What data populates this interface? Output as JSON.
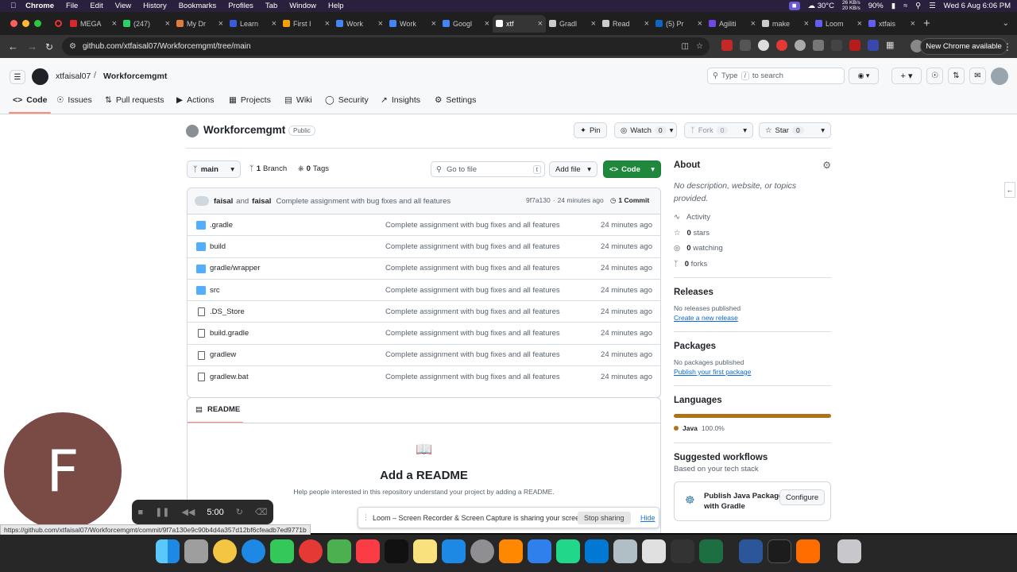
{
  "macmenu": {
    "app": "Chrome",
    "items": [
      "File",
      "Edit",
      "View",
      "History",
      "Bookmarks",
      "Profiles",
      "Tab",
      "Window",
      "Help"
    ],
    "weather": "30°C",
    "net_up": "26 KB/s",
    "net_down": "20 KB/s",
    "battery": "90%",
    "datetime": "Wed 6 Aug  6:06 PM"
  },
  "tabs": [
    {
      "title": "MEGA",
      "color": "#d9272e"
    },
    {
      "title": "(247)",
      "color": "#25d366"
    },
    {
      "title": "My Dr",
      "color": "#e07b39"
    },
    {
      "title": "Learn",
      "color": "#3b5bdb"
    },
    {
      "title": "First I",
      "color": "#f59f00"
    },
    {
      "title": "Work",
      "color": "#4285f4"
    },
    {
      "title": "Work",
      "color": "#4285f4"
    },
    {
      "title": "Googl",
      "color": "#4285f4"
    },
    {
      "title": "xtf",
      "color": "#ffffff"
    },
    {
      "title": "Gradl",
      "color": "#cccccc"
    },
    {
      "title": "Read",
      "color": "#cccccc"
    },
    {
      "title": "(5) Pr",
      "color": "#0a66c2"
    },
    {
      "title": "Agiliti",
      "color": "#7048e8"
    },
    {
      "title": "make",
      "color": "#cccccc"
    },
    {
      "title": "Loom",
      "color": "#625df5"
    },
    {
      "title": "xtfais",
      "color": "#625df5"
    }
  ],
  "address": {
    "url": "github.com/xtfaisal07/Workforcemgmt/tree/main",
    "new_chrome": "New Chrome available"
  },
  "header": {
    "owner": "xtfaisal07",
    "slash": "/",
    "repo": "Workforcemgmt",
    "search_placeholder_pre": "Type",
    "search_key": "/",
    "search_placeholder_post": "to search"
  },
  "nav": [
    "Code",
    "Issues",
    "Pull requests",
    "Actions",
    "Projects",
    "Wiki",
    "Security",
    "Insights",
    "Settings"
  ],
  "repo": {
    "title": "Workforcemgmt",
    "visibility": "Public",
    "pin": "Pin",
    "watch": "Watch",
    "watch_count": "0",
    "fork": "Fork",
    "fork_count": "0",
    "star": "Star",
    "star_count": "0"
  },
  "toolbar": {
    "branch": "main",
    "branches_count": "1",
    "branches_label": "Branch",
    "tags_count": "0",
    "tags_label": "Tags",
    "goto_placeholder": "Go to file",
    "goto_key": "t",
    "add_file": "Add file",
    "code": "Code"
  },
  "latest_commit": {
    "author1": "faisal",
    "and": "and",
    "author2": "faisal",
    "message": "Complete assignment with bug fixes and all features",
    "hash": "9f7a130",
    "dot": "·",
    "time": "24 minutes ago",
    "commits": "1 Commit"
  },
  "files": [
    {
      "name": ".gradle",
      "type": "folder",
      "message": "Complete assignment with bug fixes and all features",
      "time": "24 minutes ago"
    },
    {
      "name": "build",
      "type": "folder",
      "message": "Complete assignment with bug fixes and all features",
      "time": "24 minutes ago"
    },
    {
      "name": "gradle/wrapper",
      "type": "folder",
      "message": "Complete assignment with bug fixes and all features",
      "time": "24 minutes ago"
    },
    {
      "name": "src",
      "type": "folder",
      "message": "Complete assignment with bug fixes and all features",
      "time": "24 minutes ago"
    },
    {
      "name": ".DS_Store",
      "type": "file",
      "message": "Complete assignment with bug fixes and all features",
      "time": "24 minutes ago"
    },
    {
      "name": "build.gradle",
      "type": "file",
      "message": "Complete assignment with bug fixes and all features",
      "time": "24 minutes ago"
    },
    {
      "name": "gradlew",
      "type": "file",
      "message": "Complete assignment with bug fixes and all features",
      "time": "24 minutes ago"
    },
    {
      "name": "gradlew.bat",
      "type": "file",
      "message": "Complete assignment with bug fixes and all features",
      "time": "24 minutes ago"
    }
  ],
  "readme": {
    "tab": "README",
    "title": "Add a README",
    "text": "Help people interested in this repository understand your project by adding a README."
  },
  "about": {
    "heading": "About",
    "description": "No description, website, or topics provided.",
    "activity": "Activity",
    "stars_count": "0",
    "stars_label": "stars",
    "watching_count": "0",
    "watching_label": "watching",
    "forks_count": "0",
    "forks_label": "forks"
  },
  "releases": {
    "heading": "Releases",
    "none": "No releases published",
    "link": "Create a new release"
  },
  "packages": {
    "heading": "Packages",
    "none": "No packages published",
    "link": "Publish your first package"
  },
  "languages": {
    "heading": "Languages",
    "name": "Java",
    "percent": "100.0%",
    "color": "#b07219",
    "share": 1.0
  },
  "workflows": {
    "heading": "Suggested workflows",
    "sub": "Based on your tech stack",
    "card_title": "Publish Java Package with Gradle",
    "configure": "Configure"
  },
  "loom": {
    "initial": "F",
    "timer": "5:00",
    "share_text": "Loom – Screen Recorder & Screen Capture is sharing your screen.",
    "stop": "Stop sharing",
    "hide": "Hide"
  },
  "status_url": "https://github.com/xtfaisal07/Workforcemgmt/commit/9f7a130e9c90b4d4a357d12bf6cfeadb7ed9771b"
}
